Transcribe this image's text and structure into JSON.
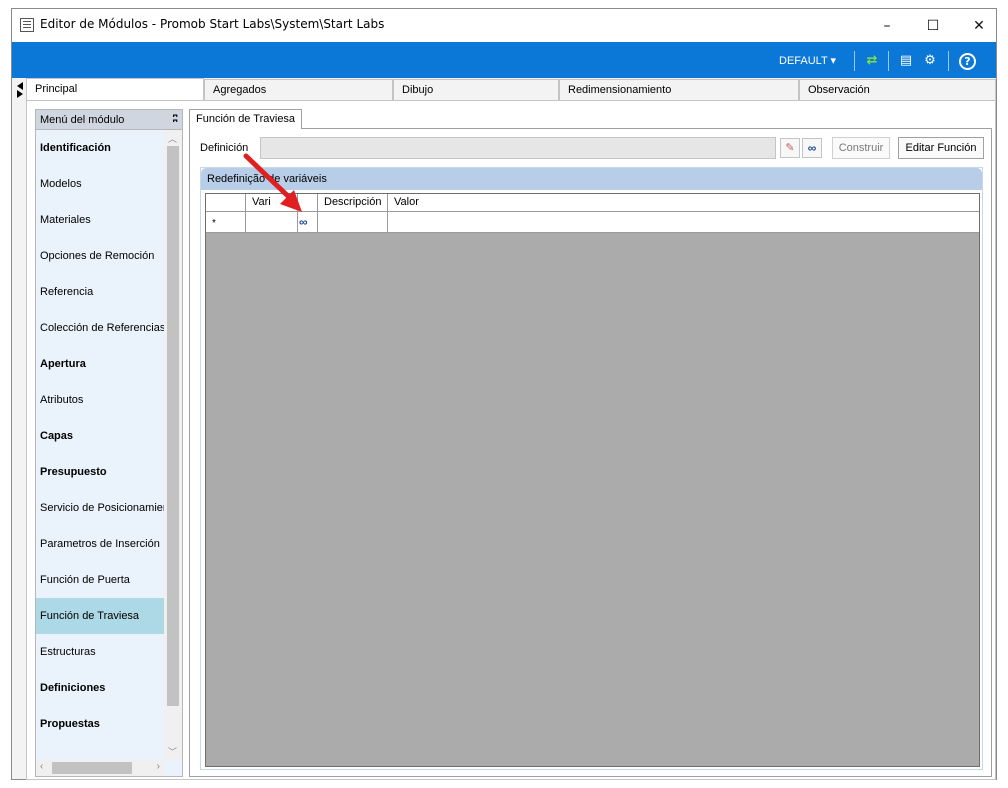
{
  "window": {
    "title": "Editor de Módulos - Promob Start Labs\\System\\Start Labs",
    "minimize": "–",
    "maximize": "☐",
    "close": "✕"
  },
  "ribbon": {
    "profile": "DEFAULT ▾",
    "icons": [
      "refresh-icon",
      "list-icon",
      "gears-icon",
      "help-icon"
    ],
    "help_glyph": "?",
    "accent_color": "#0b78d7"
  },
  "main_tabs": [
    {
      "label": "Principal",
      "active": true
    },
    {
      "label": "Agregados",
      "active": false
    },
    {
      "label": "Dibujo",
      "active": false
    },
    {
      "label": "Redimensionamiento",
      "active": false
    },
    {
      "label": "Observación",
      "active": false
    }
  ],
  "left_menu": {
    "title": "Menú del módulo",
    "pin_glyph": "ʭ",
    "items": [
      {
        "label": "Identificación",
        "bold": true,
        "selected": false
      },
      {
        "label": "Modelos",
        "bold": false,
        "selected": false
      },
      {
        "label": "Materiales",
        "bold": false,
        "selected": false
      },
      {
        "label": "Opciones de Remoción",
        "bold": false,
        "selected": false
      },
      {
        "label": "Referencia",
        "bold": false,
        "selected": false
      },
      {
        "label": "Colección de Referencias",
        "bold": false,
        "selected": false
      },
      {
        "label": "Apertura",
        "bold": true,
        "selected": false
      },
      {
        "label": "Atributos",
        "bold": false,
        "selected": false
      },
      {
        "label": "Capas",
        "bold": true,
        "selected": false
      },
      {
        "label": "Presupuesto",
        "bold": true,
        "selected": false
      },
      {
        "label": "Servicio de Posicionamiento",
        "bold": false,
        "selected": false
      },
      {
        "label": "Parametros de Inserción",
        "bold": false,
        "selected": false
      },
      {
        "label": "Función de Puerta",
        "bold": false,
        "selected": false
      },
      {
        "label": "Función de Traviesa",
        "bold": false,
        "selected": true
      },
      {
        "label": "Estructuras",
        "bold": false,
        "selected": false
      },
      {
        "label": "Definiciones",
        "bold": true,
        "selected": false
      },
      {
        "label": "Propuestas",
        "bold": true,
        "selected": false
      }
    ],
    "selected_color": "#add8e6"
  },
  "sub_tab": {
    "label": "Función de Traviesa"
  },
  "definition": {
    "label": "Definición",
    "value": "",
    "construir_label": "Construir",
    "editar_label": "Editar Función"
  },
  "variables_group": {
    "title": "Redefinição de variáveis",
    "columns": [
      "Vari",
      "",
      "Descripción",
      "Valor"
    ],
    "new_row_marker": "*"
  }
}
